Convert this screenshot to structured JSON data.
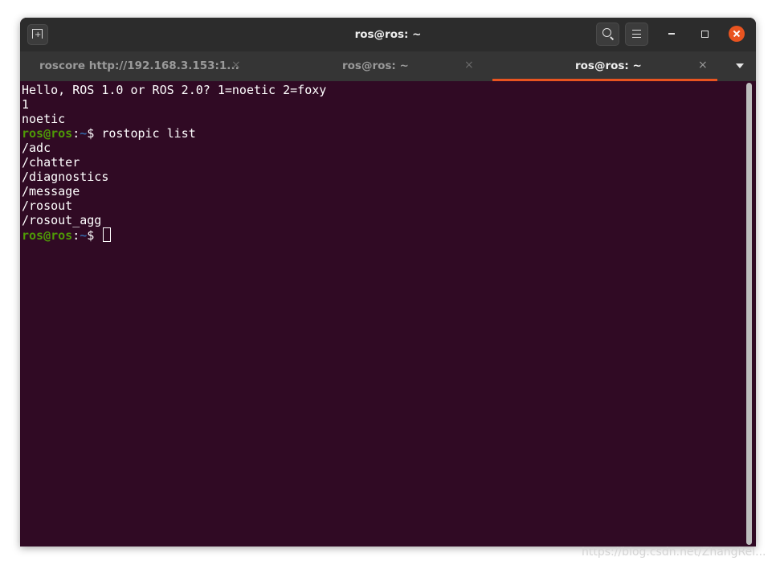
{
  "window": {
    "title": "ros@ros: ~"
  },
  "tabs": [
    {
      "label": "roscore http://192.168.3.153:1...",
      "close": "×",
      "active": false
    },
    {
      "label": "ros@ros: ~",
      "close": "×",
      "active": false
    },
    {
      "label": "ros@ros: ~",
      "close": "×",
      "active": true
    }
  ],
  "terminal": {
    "prompt_user": "ros@ros",
    "prompt_path": "~",
    "prompt_symbol": "$",
    "lines": [
      "Hello, ROS 1.0 or ROS 2.0? 1=noetic 2=foxy",
      "1",
      "noetic",
      "/adc",
      "/chatter",
      "/diagnostics",
      "/message",
      "/rosout",
      "/rosout_agg"
    ],
    "command": " rostopic list"
  },
  "icons": {
    "new_tab": "new-tab-icon",
    "search": "search-icon",
    "menu": "hamburger-menu-icon",
    "minimize": "minimize-icon",
    "maximize": "maximize-icon",
    "close": "close-icon",
    "tabs_menu": "chevron-down-icon"
  },
  "colors": {
    "terminal_background": "#300a24",
    "prompt_user": "#4e9a06",
    "prompt_path": "#3465a4",
    "accent": "#e95420"
  },
  "watermark": "https://blog.csdn.net/ZhangRel..."
}
